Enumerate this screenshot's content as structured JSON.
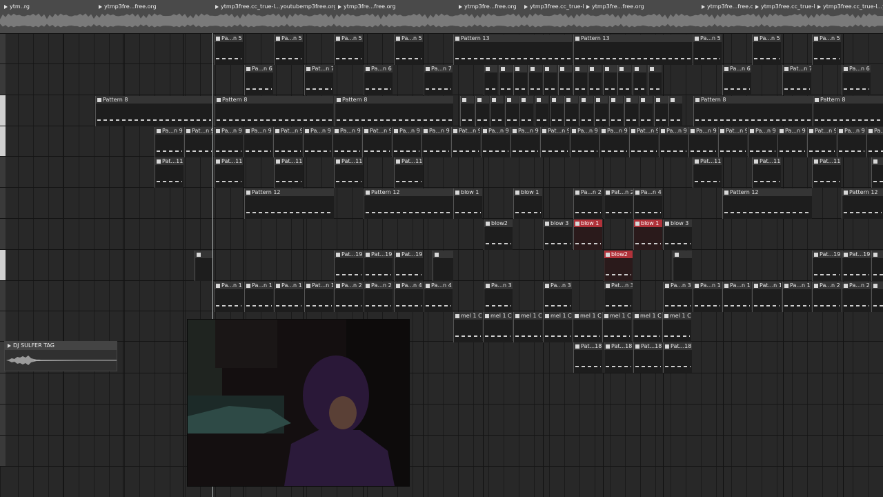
{
  "audio_track": {
    "labels": [
      "ytm..rg",
      "ytmp3fre...free.org",
      "ytmp3free.cc_true-l...youtubemp3free.org",
      "ytmp3fre...free.org",
      "ytmp3fre...free.org",
      "ytmp3free.cc_true-l...youtubemp3free.org",
      "ytmp3fre...free.org",
      "ytmp3fre...free.org",
      "ytmp3free.cc_true-l...youtubemp3free.org",
      "ytmp3fre...free.org",
      "ytmp3fre...free.org",
      "ytmp3free.cc_true-l...youtube"
    ]
  },
  "clip_labels": {
    "pan5": "Pa...n 5",
    "pan6": "Pa...n 6",
    "pan7": "Pat...n 7",
    "pan7b": "Pa...n 7",
    "pan9": "Pa...n 9",
    "pat9": "Pat...n 9",
    "pat11": "Pat...11",
    "pan1": "Pa...n 1",
    "pat1": "Pat...n 1",
    "pan2": "Pa...n 2",
    "pat2": "Pat...n 2",
    "pan4": "Pa...n 4",
    "pan3": "Pa...n 3",
    "pat3": "Pat...n 3",
    "pat19": "Pat...19",
    "pat18": "Pat...18",
    "pattern8": "Pattern 8",
    "pattern12": "Pattern 12",
    "pattern13": "Pattern 13",
    "blow1": "blow 1",
    "blow2": "blow2",
    "blow3": "blow 3",
    "mel1": "mel 1 C"
  },
  "tag_clip": {
    "label": "DJ SULFER TAG"
  },
  "webcam": {
    "description_icon": "webcam-feed"
  }
}
